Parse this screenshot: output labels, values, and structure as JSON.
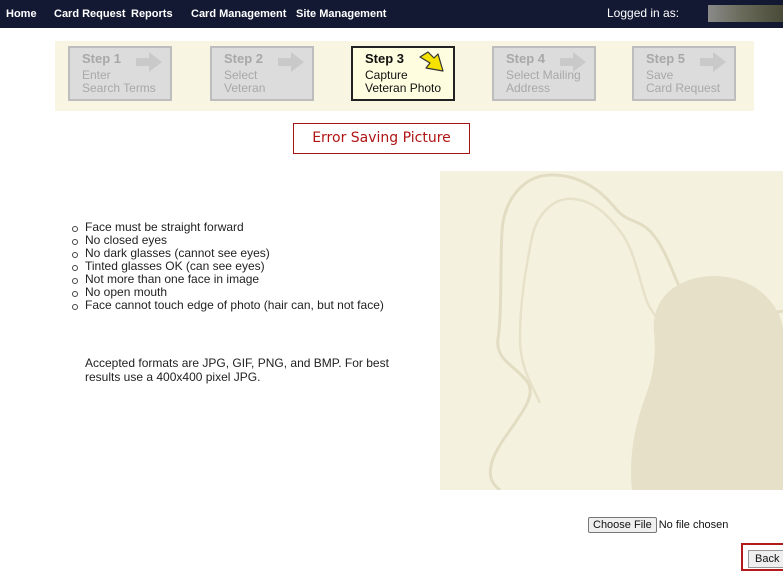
{
  "nav": {
    "items": [
      {
        "label": "Home"
      },
      {
        "label": "Card Request"
      },
      {
        "label": "Reports"
      },
      {
        "label": "Card Management"
      },
      {
        "label": "Site Management"
      }
    ],
    "logged_in_label": "Logged in as:"
  },
  "steps": [
    {
      "title": "Step 1",
      "desc": "Enter\nSearch Terms",
      "state": "inactive"
    },
    {
      "title": "Step 2",
      "desc": "Select\nVeteran",
      "state": "inactive"
    },
    {
      "title": "Step 3",
      "desc": "Capture\nVeteran Photo",
      "state": "active"
    },
    {
      "title": "Step 4",
      "desc": "Select Mailing\nAddress",
      "state": "inactive"
    },
    {
      "title": "Step 5",
      "desc": "Save\nCard Request",
      "state": "inactive"
    }
  ],
  "error_message": "Error Saving Picture",
  "requirements": [
    "Face must be straight forward",
    "No closed eyes",
    "No dark glasses (cannot see eyes)",
    "Tinted glasses OK (can see eyes)",
    "Not more than one face in image",
    "No open mouth",
    "Face cannot touch edge of photo (hair can, but not face)"
  ],
  "formats_note": "Accepted formats are JPG, GIF, PNG, and BMP. For best results use a 400x400 pixel JPG.",
  "file_input": {
    "button_label": "Choose File",
    "status": "No file chosen"
  },
  "back_label": "Back",
  "colors": {
    "nav_bg": "#131833",
    "steps_bg": "#f8f6e2",
    "active_step_bg": "#fffde0",
    "active_arrow": "#f5e200",
    "error_color": "#b01515",
    "photo_bg": "#f4f1df"
  }
}
